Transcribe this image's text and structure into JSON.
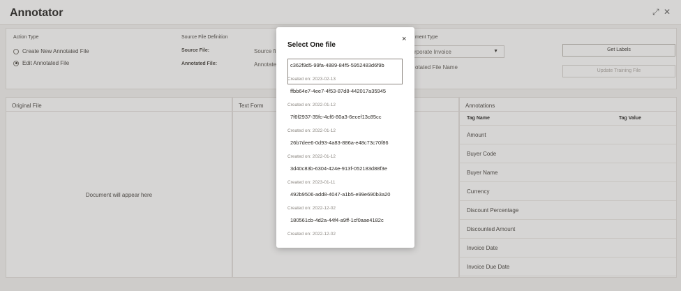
{
  "app": {
    "title": "Annotator",
    "window_controls": [
      "⤢",
      "✕"
    ]
  },
  "top_panel": {
    "action_type_label": "Action Type",
    "radio_create": "Create New Annotated File",
    "radio_edit": "Edit Annotated File",
    "source_def_label": "Source File Definition",
    "source_file_label": "Source File:",
    "source_file_value": "Source fi",
    "annotated_file_label": "Annotated File:",
    "annotated_file_value": "Annotate",
    "doc_type_label": "ment Type",
    "doc_type_value": "rporate Invoice",
    "annotated_file_name_label": "otated File Name",
    "get_labels_button": "Get Labels",
    "update_training_button": "Update Training File"
  },
  "panels": {
    "original_file_title": "Original File",
    "placeholder": "Document will appear here",
    "text_form_title": "Text Form",
    "annotations_title": "Annotations",
    "col_tag_name": "Tag Name",
    "col_tag_value": "Tag Value",
    "annotation_rows": [
      "Amount",
      "Buyer Code",
      "Buyer Name",
      "Currency",
      "Discount Percentage",
      "Discounted Amount",
      "Invoice Date",
      "Invoice Due Date"
    ]
  },
  "modal": {
    "title": "Select One file",
    "close": "×",
    "files": [
      {
        "name": "c362f9d5-99fa-4889-84f5-5952483d6f9b",
        "date": "Created on: 2023-02-13"
      },
      {
        "name": "ffbb64e7-4ee7-4f53-87d8-442017a35945",
        "date": "Created on: 2022-01-12"
      },
      {
        "name": "7f6f2937-35fc-4cf6-80a3-6ecef13c85cc",
        "date": "Created on: 2022-01-12"
      },
      {
        "name": "26b7dee6-0d93-4a83-886a-e48c73c70f86",
        "date": "Created on: 2022-01-12"
      },
      {
        "name": "3d40c83b-6304-424e-913f-052183d88f3e",
        "date": "Created on: 2023-01-11"
      },
      {
        "name": "492b9506-add8-4047-a1b5-e99e690b3a20",
        "date": "Created on: 2022-12-02"
      },
      {
        "name": "180561cb-4d2a-44f4-a9ff-1cf0aae4182c",
        "date": "Created on: 2022-12-02"
      }
    ]
  }
}
